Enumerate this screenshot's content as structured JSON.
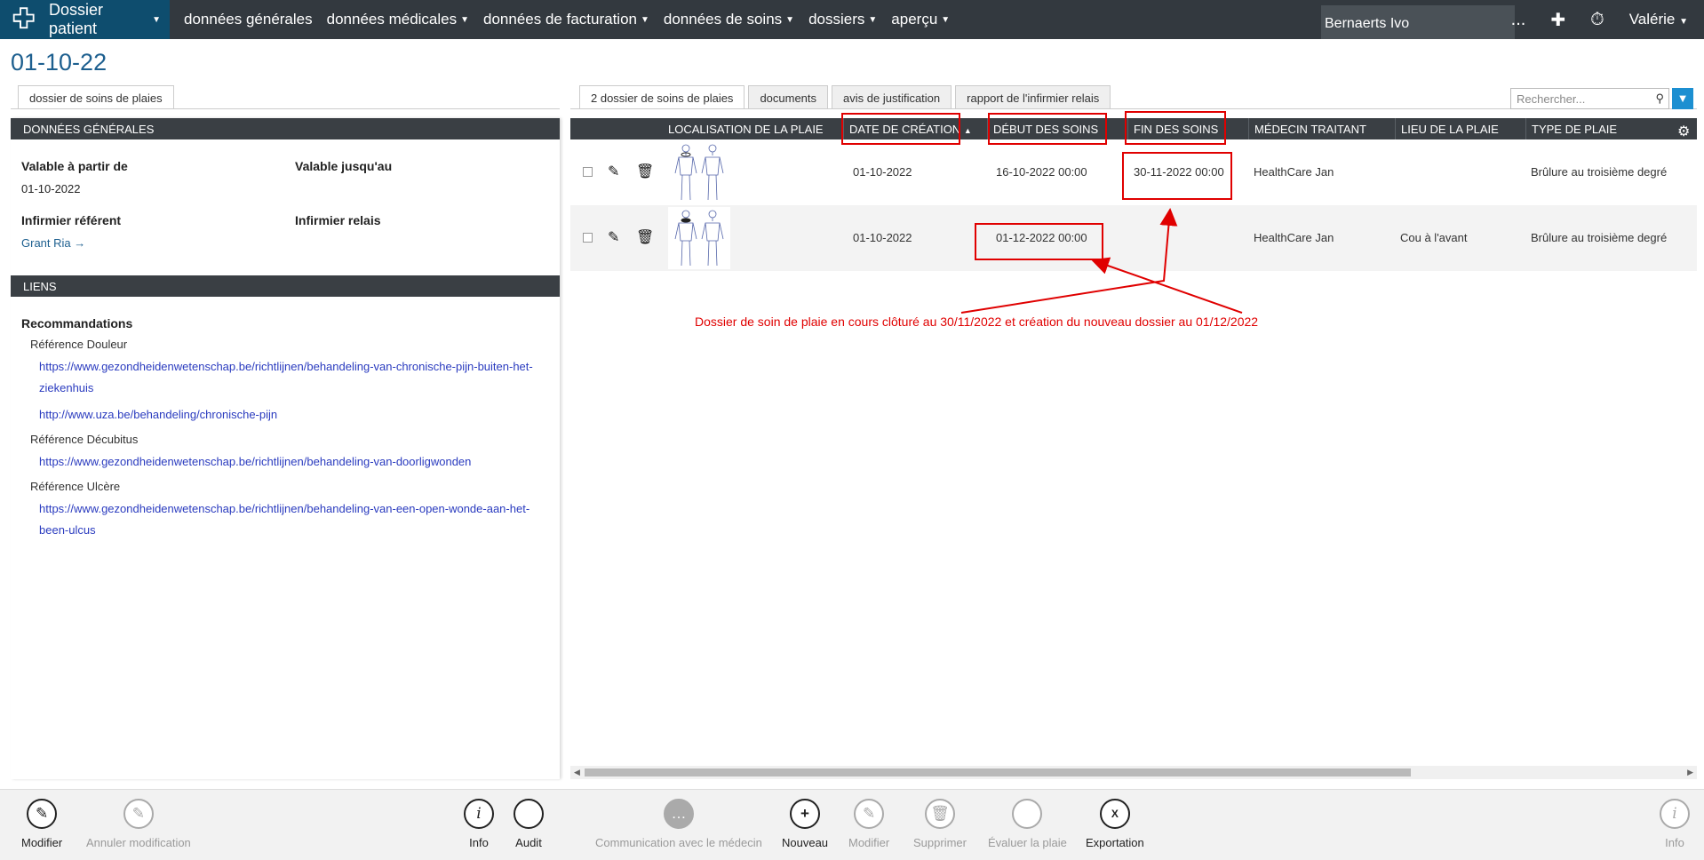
{
  "topnav": {
    "brand": "Dossier patient",
    "items": [
      "données générales",
      "données médicales",
      "données de facturation",
      "données de soins",
      "dossiers",
      "aperçu"
    ],
    "patient": "Bernaerts  Ivo",
    "more": "...",
    "user": "Valérie"
  },
  "page_title": "01-10-22",
  "left": {
    "tab": "dossier de soins de plaies",
    "sections": {
      "general": "DONNÉES GÉNÉRALES",
      "links": "LIENS"
    },
    "fields": {
      "valid_from_label": "Valable à partir de",
      "valid_from_value": "01-10-2022",
      "valid_until_label": "Valable jusqu'au",
      "referent_label": "Infirmier référent",
      "referent_value": "Grant Ria →",
      "relay_label": "Infirmier relais"
    },
    "recommendations_title": "Recommandations",
    "references": [
      {
        "title": "Référence Douleur",
        "urls": [
          "https://www.gezondheidenwetenschap.be/richtlijnen/behandeling-van-chronische-pijn-buiten-het-ziekenhuis",
          "http://www.uza.be/behandeling/chronische-pijn"
        ]
      },
      {
        "title": "Référence Décubitus",
        "urls": [
          "https://www.gezondheidenwetenschap.be/richtlijnen/behandeling-van-doorligwonden"
        ]
      },
      {
        "title": "Référence Ulcère",
        "urls": [
          "https://www.gezondheidenwetenschap.be/richtlijnen/behandeling-van-een-open-wonde-aan-het-been-ulcus"
        ]
      }
    ]
  },
  "right": {
    "tabs": [
      "2 dossier de soins de plaies",
      "documents",
      "avis de justification",
      "rapport de l'infirmier relais"
    ],
    "search_placeholder": "Rechercher...",
    "columns": [
      "LOCALISATION DE LA PLAIE",
      "DATE DE CRÉATION",
      "DÉBUT DES SOINS",
      "FIN DES SOINS",
      "MÉDECIN TRAITANT",
      "LIEU DE LA PLAIE",
      "TYPE DE PLAIE"
    ],
    "sort_indicator": "▲",
    "rows": [
      {
        "date_creation": "01-10-2022",
        "debut": "16-10-2022 00:00",
        "fin": "30-11-2022 00:00",
        "medecin": "HealthCare Jan",
        "lieu": "",
        "type": "Brûlure au troisième degré"
      },
      {
        "date_creation": "01-10-2022",
        "debut": "01-12-2022 00:00",
        "fin": "",
        "medecin": "HealthCare Jan",
        "lieu": "Cou à l'avant",
        "type": "Brûlure au troisième degré"
      }
    ],
    "annotation": "Dossier de soin de plaie en cours clôturé au 30/11/2022 et création du  nouveau dossier au 01/12/2022"
  },
  "toolbar": {
    "modifier": "Modifier",
    "annuler": "Annuler modification",
    "info": "Info",
    "audit": "Audit",
    "communication": "Communication avec le médecin",
    "nouveau": "Nouveau",
    "modifier2": "Modifier",
    "supprimer": "Supprimer",
    "evaluer": "Évaluer la plaie",
    "exportation": "Exportation",
    "info2": "Info"
  },
  "colors": {
    "nav": "#33393f",
    "brand": "#0e4d6e",
    "header": "#3a3f44",
    "link": "#2a3bbf",
    "annotation": "#e00000"
  }
}
